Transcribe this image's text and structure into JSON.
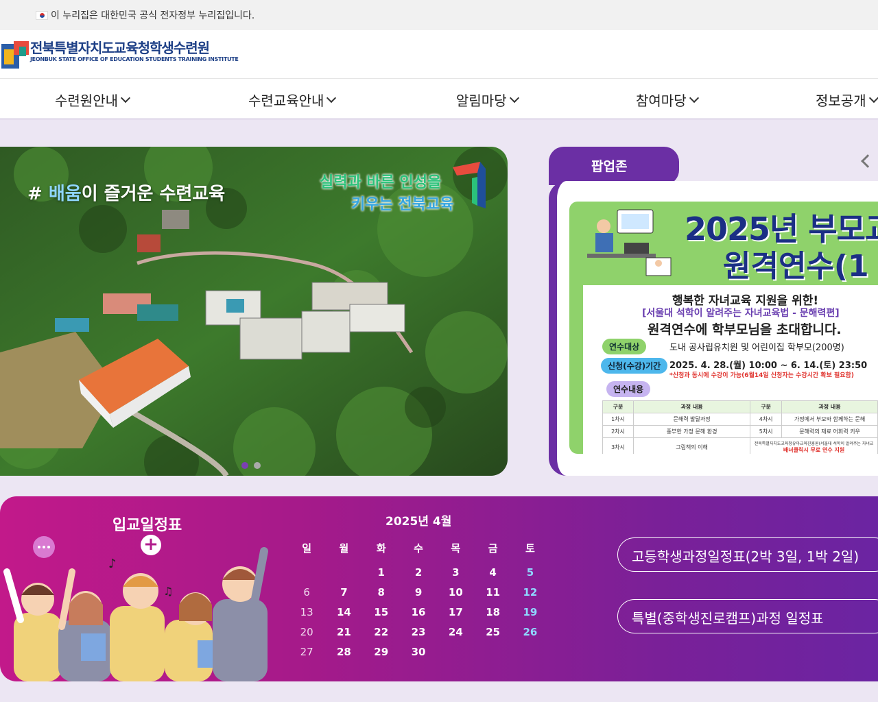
{
  "gov_bar": {
    "text": "이 누리집은 대한민국 공식 전자정부 누리집입니다."
  },
  "logo": {
    "name_kr": "전북특별자치도교육청학생수련원",
    "name_en": "JEONBUK STATE OFFICE OF EDUCATION STUDENTS TRAINING INSTITUTE"
  },
  "nav": {
    "items": [
      {
        "label": "수련원안내"
      },
      {
        "label": "수련교육안내"
      },
      {
        "label": "알림마당"
      },
      {
        "label": "참여마당"
      },
      {
        "label": "정보공개"
      }
    ]
  },
  "hero": {
    "hash": "# ",
    "highlight": "배움",
    "caption_rest": "이 즐거운 수련교육",
    "slogan_line1": "실력과 바른 인성을",
    "slogan_line2": "키우는 전북교육",
    "slide_count": 2,
    "active_slide": 1
  },
  "popup": {
    "tab_label": "팝업존",
    "poster": {
      "heading_1": "2025년 부모교",
      "heading_2": "원격연수(1",
      "line_1": "행복한 자녀교육 지원을 위한!",
      "line_2": "[서울대 석학이 알려주는 자녀교육법 - 문해력편]",
      "line_3": "원격연수에 학부모님을 초대합니다.",
      "target_label": "연수대상",
      "target_value": "도내 공사립유치원 및 어린이집 학부모(200명)",
      "period_label": "신청(수강)기간",
      "period_value": "2025. 4. 28.(월) 10:00 ~ 6. 14.(토) 23:50",
      "period_note": "*신청과 동시에 수강이 가능(6월14일 신청자는 수강시간 확보 필요함)",
      "content_label": "연수내용",
      "table": {
        "headers": [
          "구분",
          "과정 내용",
          "구분",
          "과정 내용"
        ],
        "rows": [
          [
            "1차시",
            "문해력 발달과정",
            "4차시",
            "가정에서 부모와 함께하는 문해"
          ],
          [
            "2차시",
            "풍부한 가정 문해 환경",
            "5차시",
            "문해력의 재료 어휘력 키우"
          ],
          [
            "3차시",
            "그림책의 이해",
            "",
            "전북특별자치도교육청유아교육진흥원(서울대 석학이 알려주는 자녀교"
          ]
        ],
        "footer_note": "배너클릭시 무료 연수 지원"
      }
    }
  },
  "schedule": {
    "title": "입교일정표",
    "plus": "+",
    "calendar_title": "2025년 4월",
    "weekdays": [
      "일",
      "월",
      "화",
      "수",
      "목",
      "금",
      "토"
    ],
    "weeks": [
      [
        "",
        "",
        "1",
        "2",
        "3",
        "4",
        "5"
      ],
      [
        "6",
        "7",
        "8",
        "9",
        "10",
        "11",
        "12"
      ],
      [
        "13",
        "14",
        "15",
        "16",
        "17",
        "18",
        "19"
      ],
      [
        "20",
        "21",
        "22",
        "23",
        "24",
        "25",
        "26"
      ],
      [
        "27",
        "28",
        "29",
        "30",
        "",
        "",
        ""
      ]
    ],
    "buttons": [
      {
        "label": "고등학생과정일정표(2박 3일, 1박 2일)"
      },
      {
        "label": "특별(중학생진로캠프)과정 일정표"
      }
    ]
  },
  "colors": {
    "brand_purple": "#6b2fa4",
    "banner_magenta": "#c2198a",
    "logo_navy": "#1d3f86"
  }
}
